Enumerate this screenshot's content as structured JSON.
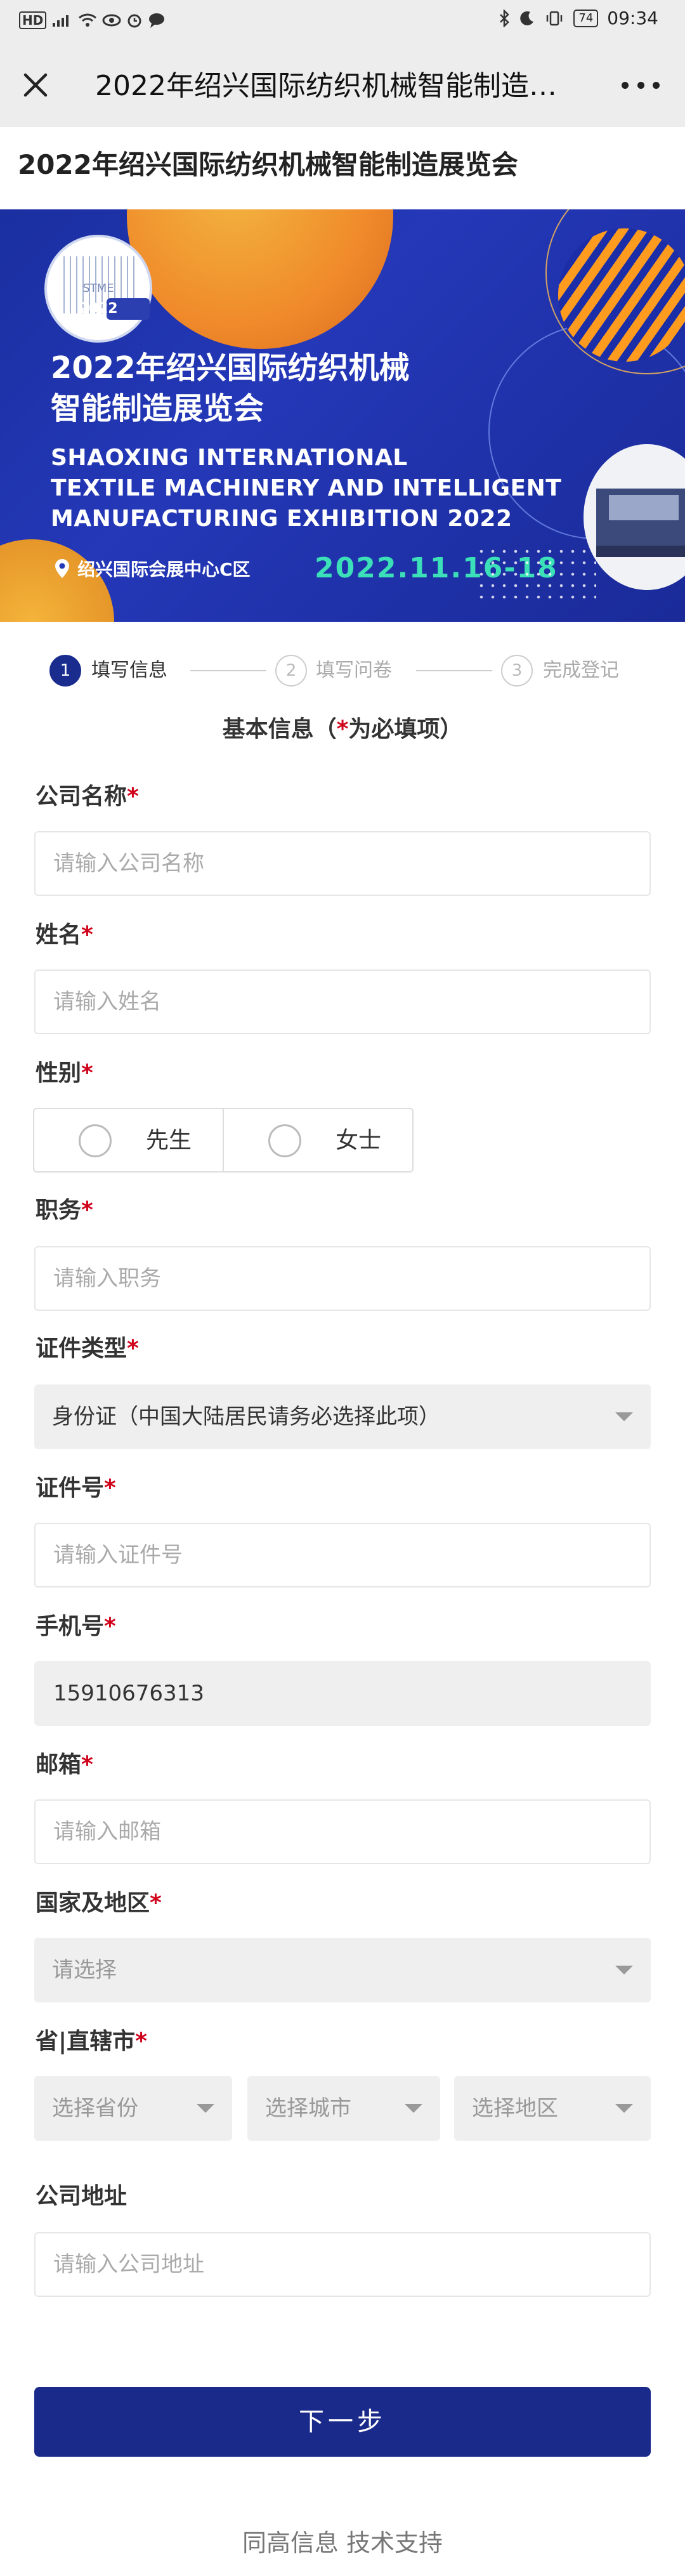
{
  "status_bar": {
    "left_text": "HD ⁴⁶ᵢₗₗ",
    "hd": "HD",
    "battery": "74",
    "time": "09:34"
  },
  "titlebar": {
    "title": "2022年绍兴国际纺织机械智能制造…"
  },
  "page": {
    "heading": "2022年绍兴国际纺织机械智能制造展览会"
  },
  "banner": {
    "logo_text": "STME",
    "logo_year": "2022",
    "title_cn_line1": "2022年绍兴国际纺织机械",
    "title_cn_line2": "智能制造展览会",
    "title_en_line1": "SHAOXING INTERNATIONAL",
    "title_en_line2": "TEXTILE MACHINERY AND INTELLIGENT",
    "title_en_line3": "MANUFACTURING EXHIBITION 2022",
    "location": "绍兴国际会展中心C区",
    "date": "2022.11.16-18"
  },
  "steps": [
    {
      "num": "1",
      "label": "填写信息"
    },
    {
      "num": "2",
      "label": "填写问卷"
    },
    {
      "num": "3",
      "label": "完成登记"
    }
  ],
  "section": {
    "title_prefix": "基本信息（",
    "title_star": "*",
    "title_suffix": "为必填项）"
  },
  "form": {
    "required_mark": "*",
    "company": {
      "label": "公司名称",
      "placeholder": "请输入公司名称"
    },
    "name": {
      "label": "姓名",
      "placeholder": "请输入姓名"
    },
    "gender": {
      "label": "性别",
      "options": [
        "先生",
        "女士"
      ]
    },
    "position": {
      "label": "职务",
      "placeholder": "请输入职务"
    },
    "id_type": {
      "label": "证件类型",
      "value": "身份证（中国大陆居民请务必选择此项）"
    },
    "id_number": {
      "label": "证件号",
      "placeholder": "请输入证件号"
    },
    "phone": {
      "label": "手机号",
      "value": "15910676313"
    },
    "email": {
      "label": "邮箱",
      "placeholder": "请输入邮箱"
    },
    "country": {
      "label": "国家及地区",
      "value": "请选择"
    },
    "province": {
      "label": "省|直辖市",
      "province": "选择省份",
      "city": "选择城市",
      "district": "选择地区"
    },
    "address": {
      "label": "公司地址",
      "placeholder": "请输入公司地址"
    }
  },
  "next_button": "下一步",
  "footer": "同高信息  技术支持"
}
